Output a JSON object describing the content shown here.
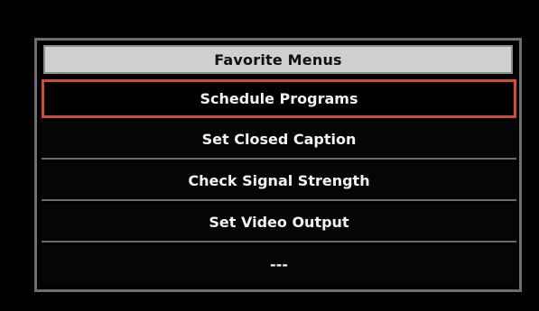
{
  "menu": {
    "title": "Favorite Menus",
    "items": [
      {
        "label": "Schedule Programs",
        "selected": true
      },
      {
        "label": "Set Closed Caption",
        "selected": false
      },
      {
        "label": "Check Signal Strength",
        "selected": false
      },
      {
        "label": "Set Video Output",
        "selected": false
      },
      {
        "label": "---",
        "selected": false
      }
    ]
  },
  "colors": {
    "background": "#000000",
    "panel_border": "#6e6e6e",
    "header_bg": "#cfcfcf",
    "selected_border": "#d24a3a",
    "text": "#f2f2f2"
  }
}
